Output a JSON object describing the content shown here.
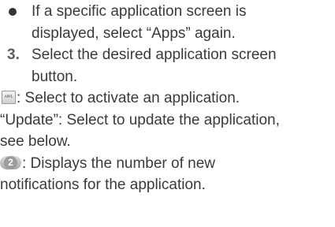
{
  "content": {
    "bullet_line1": "If a specific application screen is",
    "bullet_line2": "displayed, select “Apps” again.",
    "step_number": "3.",
    "step_line1": "Select the desired application screen",
    "step_line2": "button.",
    "app_icon_label": "APP1",
    "app_icon_text": ": Select to activate an application.",
    "update_line1": "“Update”: Select to update the application,",
    "update_line2": "see below.",
    "badge_number": "2",
    "badge_line1": ": Displays the number of new",
    "badge_line2": "notifications for the application."
  }
}
